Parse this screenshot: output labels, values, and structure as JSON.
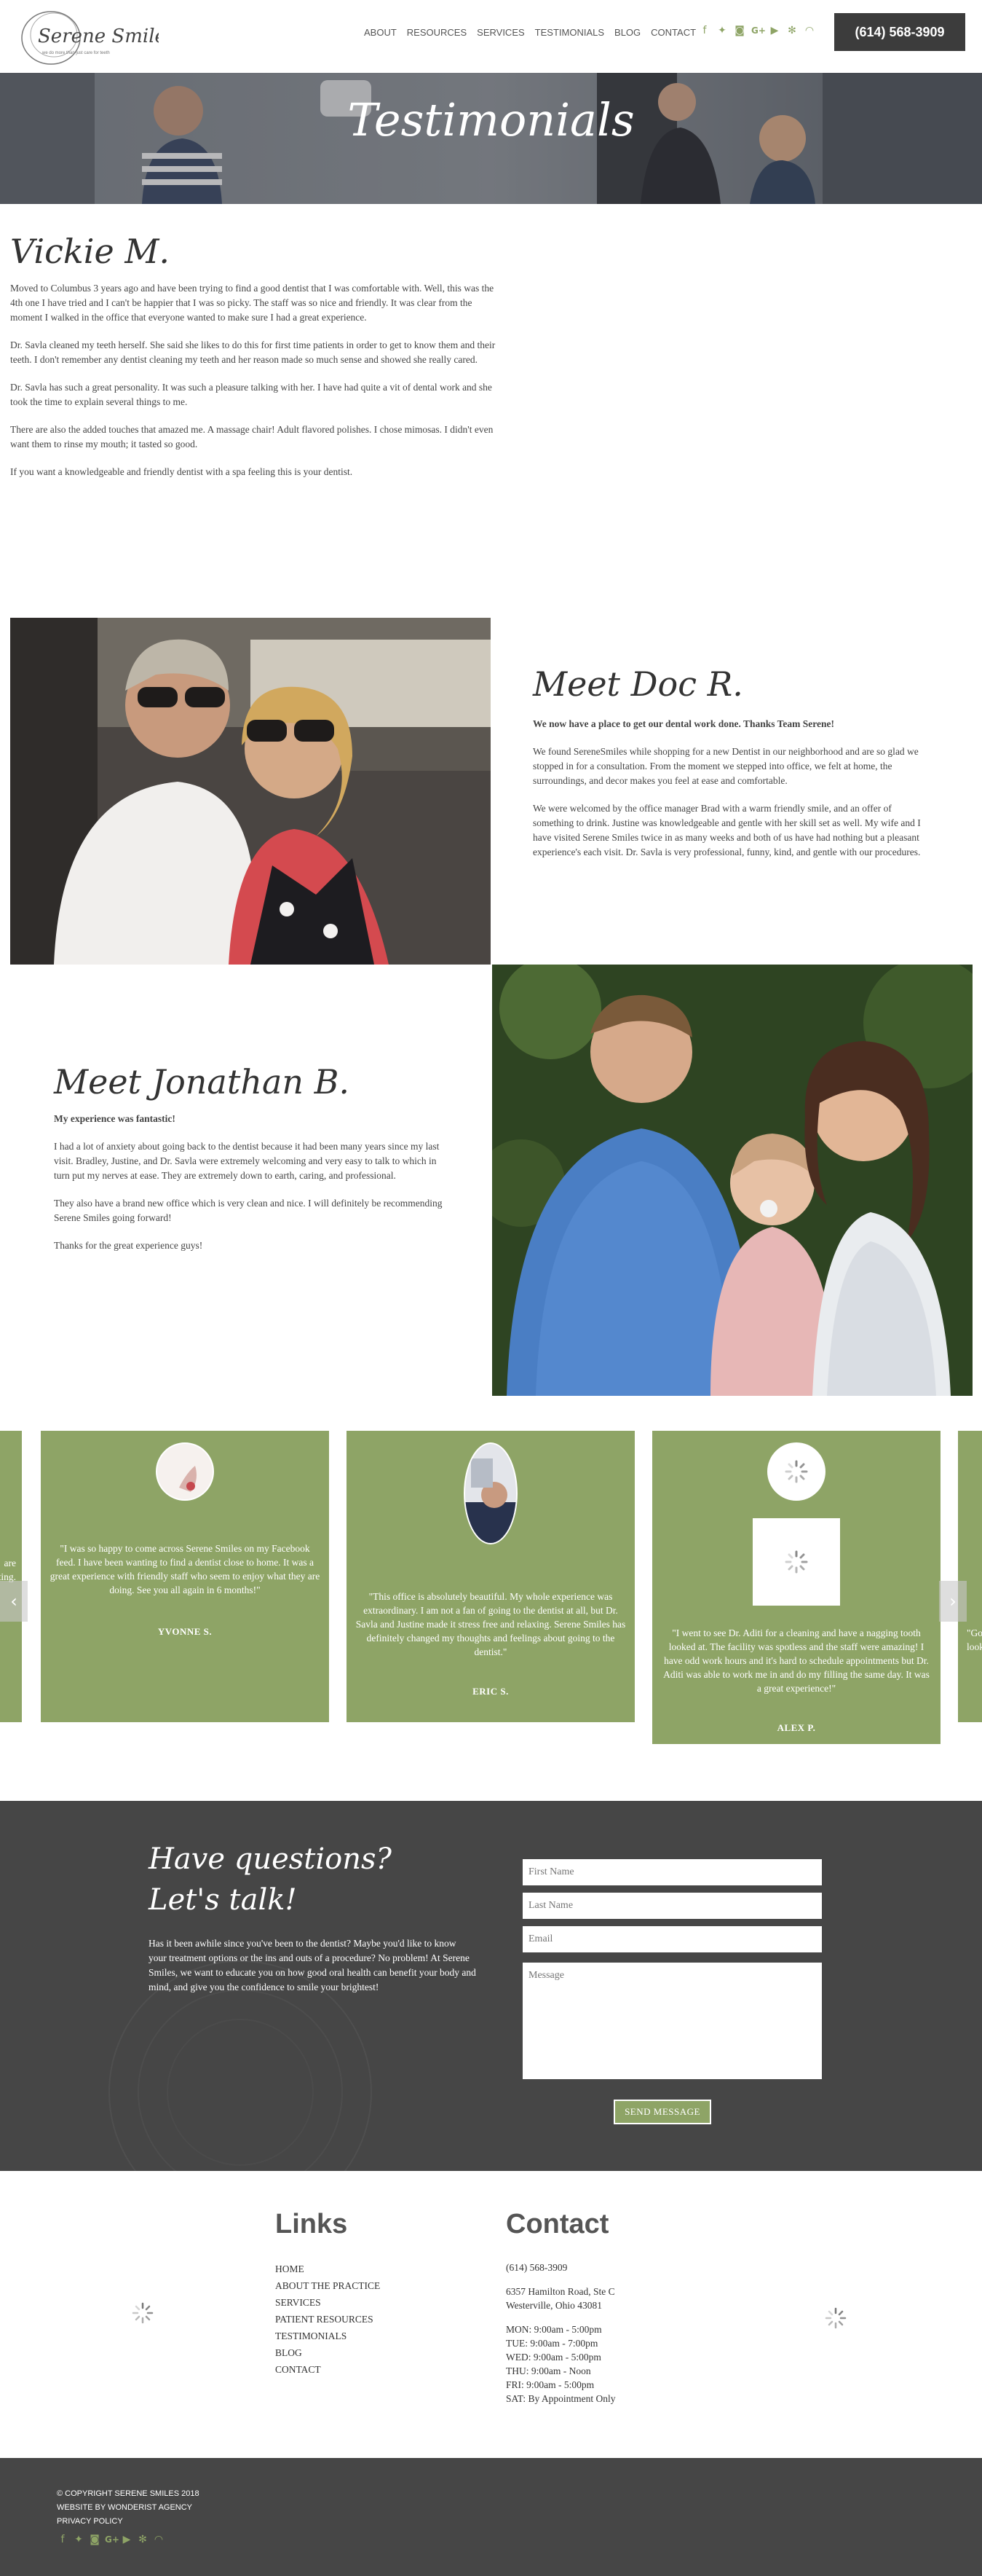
{
  "header": {
    "logo_text": "Serene Smiles",
    "logo_tagline": "we do more than just care for teeth",
    "nav": [
      "ABOUT",
      "RESOURCES",
      "SERVICES",
      "TESTIMONIALS",
      "BLOG",
      "CONTACT"
    ],
    "social_icons": [
      "facebook-icon",
      "twitter-icon",
      "instagram-icon",
      "google-plus-icon",
      "youtube-icon",
      "yelp-icon",
      "rss-icon"
    ],
    "phone": "(614) 568-3909"
  },
  "hero": {
    "title": "Testimonials"
  },
  "testimonials": {
    "vickie": {
      "name": "Vickie M.",
      "paragraphs": [
        "Moved to Columbus 3 years ago and have been trying to find a good dentist that I was comfortable with. Well, this was the 4th one I have tried and I can't be happier that I was so picky. The staff was so nice and friendly. It was clear from the moment I walked in the office that everyone wanted to make sure I had a great experience.",
        "Dr. Savla cleaned my teeth herself. She said she likes to do this for first time patients in order to get to know them and their teeth. I don't remember any dentist cleaning my teeth and her reason made so much sense and showed she really cared.",
        "Dr. Savla has such a great personality. It was such a pleasure talking with her. I have had quite a vit of dental work and she took the time to explain several things to me.",
        "There are also the added touches that amazed me. A massage chair! Adult flavored polishes. I chose mimosas. I didn't even want them to rinse my mouth; it tasted so good.",
        "If you want a knowledgeable and friendly dentist with a spa feeling this is your dentist."
      ]
    },
    "doc": {
      "name": "Meet Doc R.",
      "lead": "We now have a place to get our dental work done. Thanks Team Serene!",
      "paragraphs": [
        "We found SereneSmiles while shopping for a new Dentist in our neighborhood and are so glad we stopped in for a consultation. From the moment we stepped into office, we felt at home, the surroundings, and decor makes you feel at ease and comfortable.",
        "We were welcomed by the office manager Brad with a warm friendly smile, and an offer of something to drink. Justine was knowledgeable and gentle with her skill set as well. My wife and I have visited Serene Smiles twice in as many weeks and both of us have had nothing but a pleasant experience's each visit. Dr. Savla is very professional, funny, kind, and gentle with our procedures."
      ]
    },
    "jonathan": {
      "name": "Meet Jonathan B.",
      "lead": "My experience was fantastic!",
      "paragraphs": [
        "I had a lot of anxiety about going back to the dentist because it had been many years since my last visit. Bradley, Justine, and Dr. Savla were extremely welcoming and very easy to talk to which in turn put my nerves at ease. They are extremely down to earth, caring, and professional.",
        "They also have a brand new office which is very clean and nice. I will definitely  be recommending Serene Smiles going forward!",
        "Thanks for the great experience guys!"
      ]
    }
  },
  "carousel": {
    "partial_left": [
      "are",
      "ting."
    ],
    "partial_right": [
      "\"Go",
      "look"
    ],
    "cards": [
      {
        "quote": "\"I was so happy to come across Serene Smiles on my Facebook feed. I have been wanting to find a dentist close to home. It was a great experience with friendly staff who seem to enjoy what they are doing. See you all again in 6 months!\"",
        "author": "YVONNE S."
      },
      {
        "quote": "\"This office is absolutely beautiful. My whole experience was extraordinary. I am not a fan of going to the dentist at all, but Dr. Savla and Justine made it stress free and relaxing. Serene Smiles has definitely changed my thoughts and feelings about going to the dentist.\"",
        "author": "ERIC S."
      },
      {
        "quote": "\"I went to see Dr. Aditi for a cleaning and have a nagging tooth looked at. The facility was spotless and the staff were amazing! I have odd work hours and it's hard to schedule appointments but Dr. Aditi was able to work me in and do my filling the same day. It was a great experience!\"",
        "author": "ALEX P."
      }
    ],
    "prev_label": "‹",
    "next_label": "›"
  },
  "contact_section": {
    "title": "Have questions? Let's talk!",
    "body": "Has it been awhile since you've been to the dentist? Maybe you'd like to know your treatment options or the ins and outs of a procedure? No problem! At Serene Smiles, we want to educate you on how good oral health can benefit your body and mind, and give you the confidence to smile your brightest!",
    "first_name_placeholder": "First Name",
    "last_name_placeholder": "Last Name",
    "email_placeholder": "Email",
    "message_placeholder": "Message",
    "send_label": "SEND MESSAGE"
  },
  "footer": {
    "links_heading": "Links",
    "links": [
      "HOME",
      "ABOUT THE PRACTICE",
      "SERVICES",
      "PATIENT RESOURCES",
      "TESTIMONIALS",
      "BLOG",
      "CONTACT"
    ],
    "contact_heading": "Contact",
    "phone": "(614) 568-3909",
    "address_line1": "6357 Hamilton Road, Ste C",
    "address_line2": "Westerville, Ohio 43081",
    "hours": [
      "MON: 9:00am - 5:00pm",
      "TUE: 9:00am - 7:00pm",
      "WED: 9:00am - 5:00pm",
      "THU: 9:00am - Noon",
      "FRI: 9:00am - 5:00pm",
      "SAT: By Appointment Only"
    ]
  },
  "bottom_bar": {
    "copyright": "© COPYRIGHT SERENE SMILES 2018",
    "credit": "WEBSITE BY WONDERIST AGENCY",
    "privacy": "PRIVACY POLICY"
  },
  "colors": {
    "accent": "#8ea466",
    "dark": "#464646",
    "button_dark": "#3c3c3c"
  }
}
